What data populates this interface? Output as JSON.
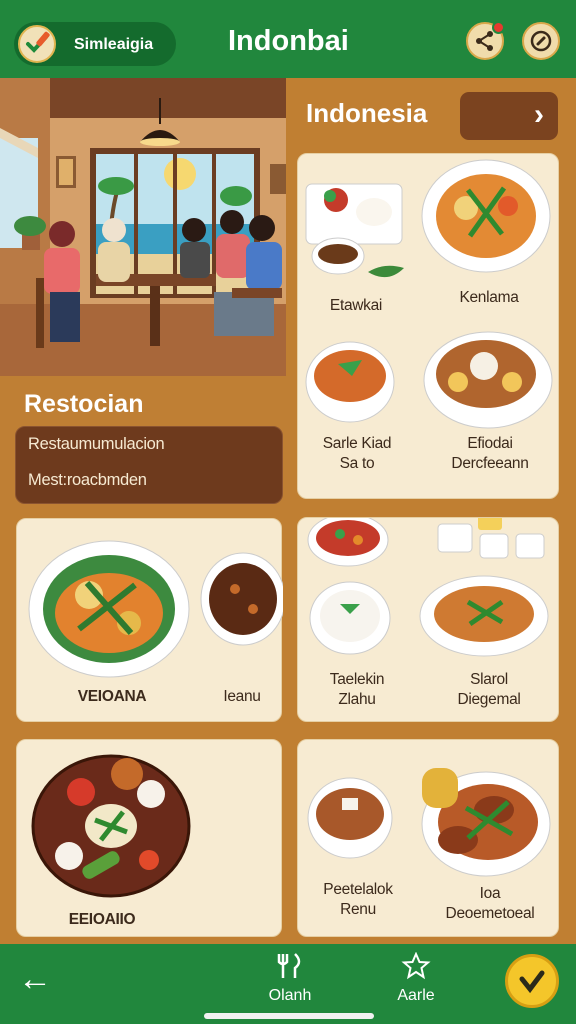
{
  "header": {
    "pill_label": "Simleaigia",
    "title": "Indonbai",
    "left_icon": "checkmark-pencil-icon",
    "right_icons": [
      "share-icon",
      "compass-icon"
    ]
  },
  "hero": {
    "section_title": "Restocian",
    "lines": [
      "Restaumumulacion",
      "Mest:roacbmden"
    ]
  },
  "panel": {
    "title": "Indonesia",
    "arrow": "›"
  },
  "cards": {
    "featured": {
      "dish1": "Etawkai",
      "dish2": "Kenlama",
      "dish3": "Sarle Kiad\nSa to",
      "dish4": "Efiodai\nDercfeeann"
    },
    "left1": {
      "dish1": "VEIOANA",
      "dish2": "Ieanu"
    },
    "right1": {
      "dish1": "Taelekin\nZlahu",
      "dish2": "Slarol\nDiegemal"
    },
    "left2": {
      "dish1": "EEIOAIIO"
    },
    "right2": {
      "dish1": "Peetelalok\nRenu",
      "dish2": "Ioa\nDeoemetoeal"
    }
  },
  "bottom_nav": {
    "back": "←",
    "items": [
      {
        "label": "Olanh",
        "icon": "utensils-icon"
      },
      {
        "label": "Aarle",
        "icon": "star-icon"
      }
    ],
    "fab_icon": "check-icon"
  },
  "colors": {
    "green": "#21873d",
    "brown": "#c07f32",
    "dark_brown": "#6e3a1d",
    "card": "#f7ebd2"
  }
}
